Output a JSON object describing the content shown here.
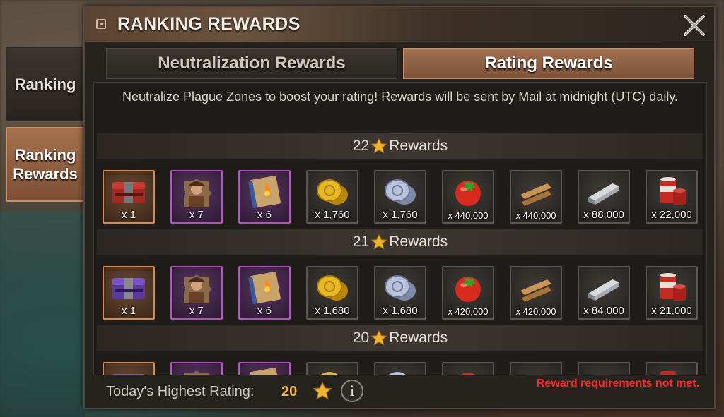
{
  "title": "RANKING REWARDS",
  "side_tabs": {
    "ranking": "Ranking",
    "ranking_rewards_line1": "Ranking",
    "ranking_rewards_line2": "Rewards"
  },
  "top_tabs": {
    "neutralization": "Neutralization Rewards",
    "rating": "Rating Rewards"
  },
  "description": "Neutralize Plague Zones to boost your rating! Rewards will be sent by Mail at midnight (UTC) daily.",
  "tiers": [
    {
      "stars": "22",
      "label": "Rewards",
      "items": [
        {
          "icon": "red-crate-icon",
          "qty": "x 1"
        },
        {
          "icon": "hero-puzzle-icon",
          "qty": "x 7"
        },
        {
          "icon": "burning-manual-icon",
          "qty": "x 6"
        },
        {
          "icon": "gold-coin-icon",
          "qty": "x 1,760"
        },
        {
          "icon": "silver-coin-icon",
          "qty": "x 1,760"
        },
        {
          "icon": "tomato-food-icon",
          "qty": "x 440,000"
        },
        {
          "icon": "wood-planks-icon",
          "qty": "x 440,000"
        },
        {
          "icon": "steel-ingot-icon",
          "qty": "x 88,000"
        },
        {
          "icon": "oil-barrel-icon",
          "qty": "x 22,000"
        }
      ]
    },
    {
      "stars": "21",
      "label": "Rewards",
      "items": [
        {
          "icon": "purple-crate-icon",
          "qty": "x 1"
        },
        {
          "icon": "hero-puzzle-icon",
          "qty": "x 7"
        },
        {
          "icon": "burning-manual-icon",
          "qty": "x 6"
        },
        {
          "icon": "gold-coin-icon",
          "qty": "x 1,680"
        },
        {
          "icon": "silver-coin-icon",
          "qty": "x 1,680"
        },
        {
          "icon": "tomato-food-icon",
          "qty": "x 420,000"
        },
        {
          "icon": "wood-planks-icon",
          "qty": "x 420,000"
        },
        {
          "icon": "steel-ingot-icon",
          "qty": "x 84,000"
        },
        {
          "icon": "oil-barrel-icon",
          "qty": "x 21,000"
        }
      ]
    },
    {
      "stars": "20",
      "label": "Rewards"
    }
  ],
  "footer": {
    "label": "Today's Highest Rating:",
    "value": "20",
    "warning": "Reward requirements not met."
  },
  "colors": {
    "accent": "#f0b24a",
    "warning": "#ff2a2a",
    "tab_active": "#9a6645",
    "rarity_orange": "#d78a4a",
    "rarity_purple": "#b64fc8"
  }
}
